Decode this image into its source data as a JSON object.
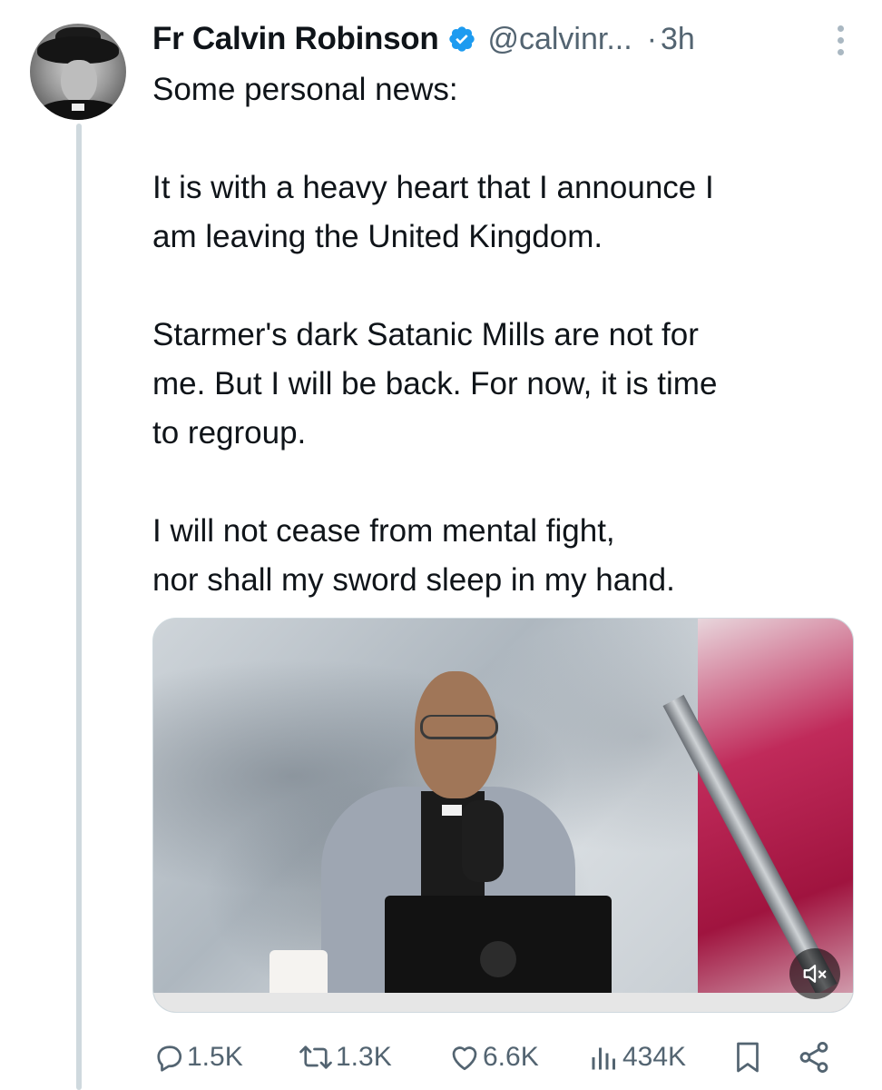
{
  "tweet": {
    "author_name": "Fr Calvin Robinson",
    "handle": "@calvinr...",
    "separator": "·",
    "time": "3h",
    "text_lines": {
      "l1": "Some personal news:",
      "l2": "It is with a heavy heart that I announce I",
      "l3": "am leaving the United Kingdom.",
      "l4": "Starmer's dark Satanic Mills are not for",
      "l5": "me. But I will be back. For now, it is time",
      "l6": "to regroup.",
      "l7": "I will not cease from mental fight,",
      "l8": "nor shall my sword sleep in my hand."
    }
  },
  "actions": {
    "replies": "1.5K",
    "reposts": "1.3K",
    "likes": "6.6K",
    "views": "434K"
  },
  "icons": {
    "verified": "verified-badge-icon",
    "more": "more-vertical-icon",
    "mute": "muted-speaker-icon",
    "reply": "reply-bubble-icon",
    "repost": "repost-arrows-icon",
    "like": "heart-icon",
    "views": "bar-chart-icon",
    "bookmark": "bookmark-icon",
    "share": "share-icon"
  },
  "colors": {
    "text": "#0f1419",
    "secondary": "#536471",
    "verified": "#1d9bf0",
    "thread_line": "#cfd9de"
  }
}
